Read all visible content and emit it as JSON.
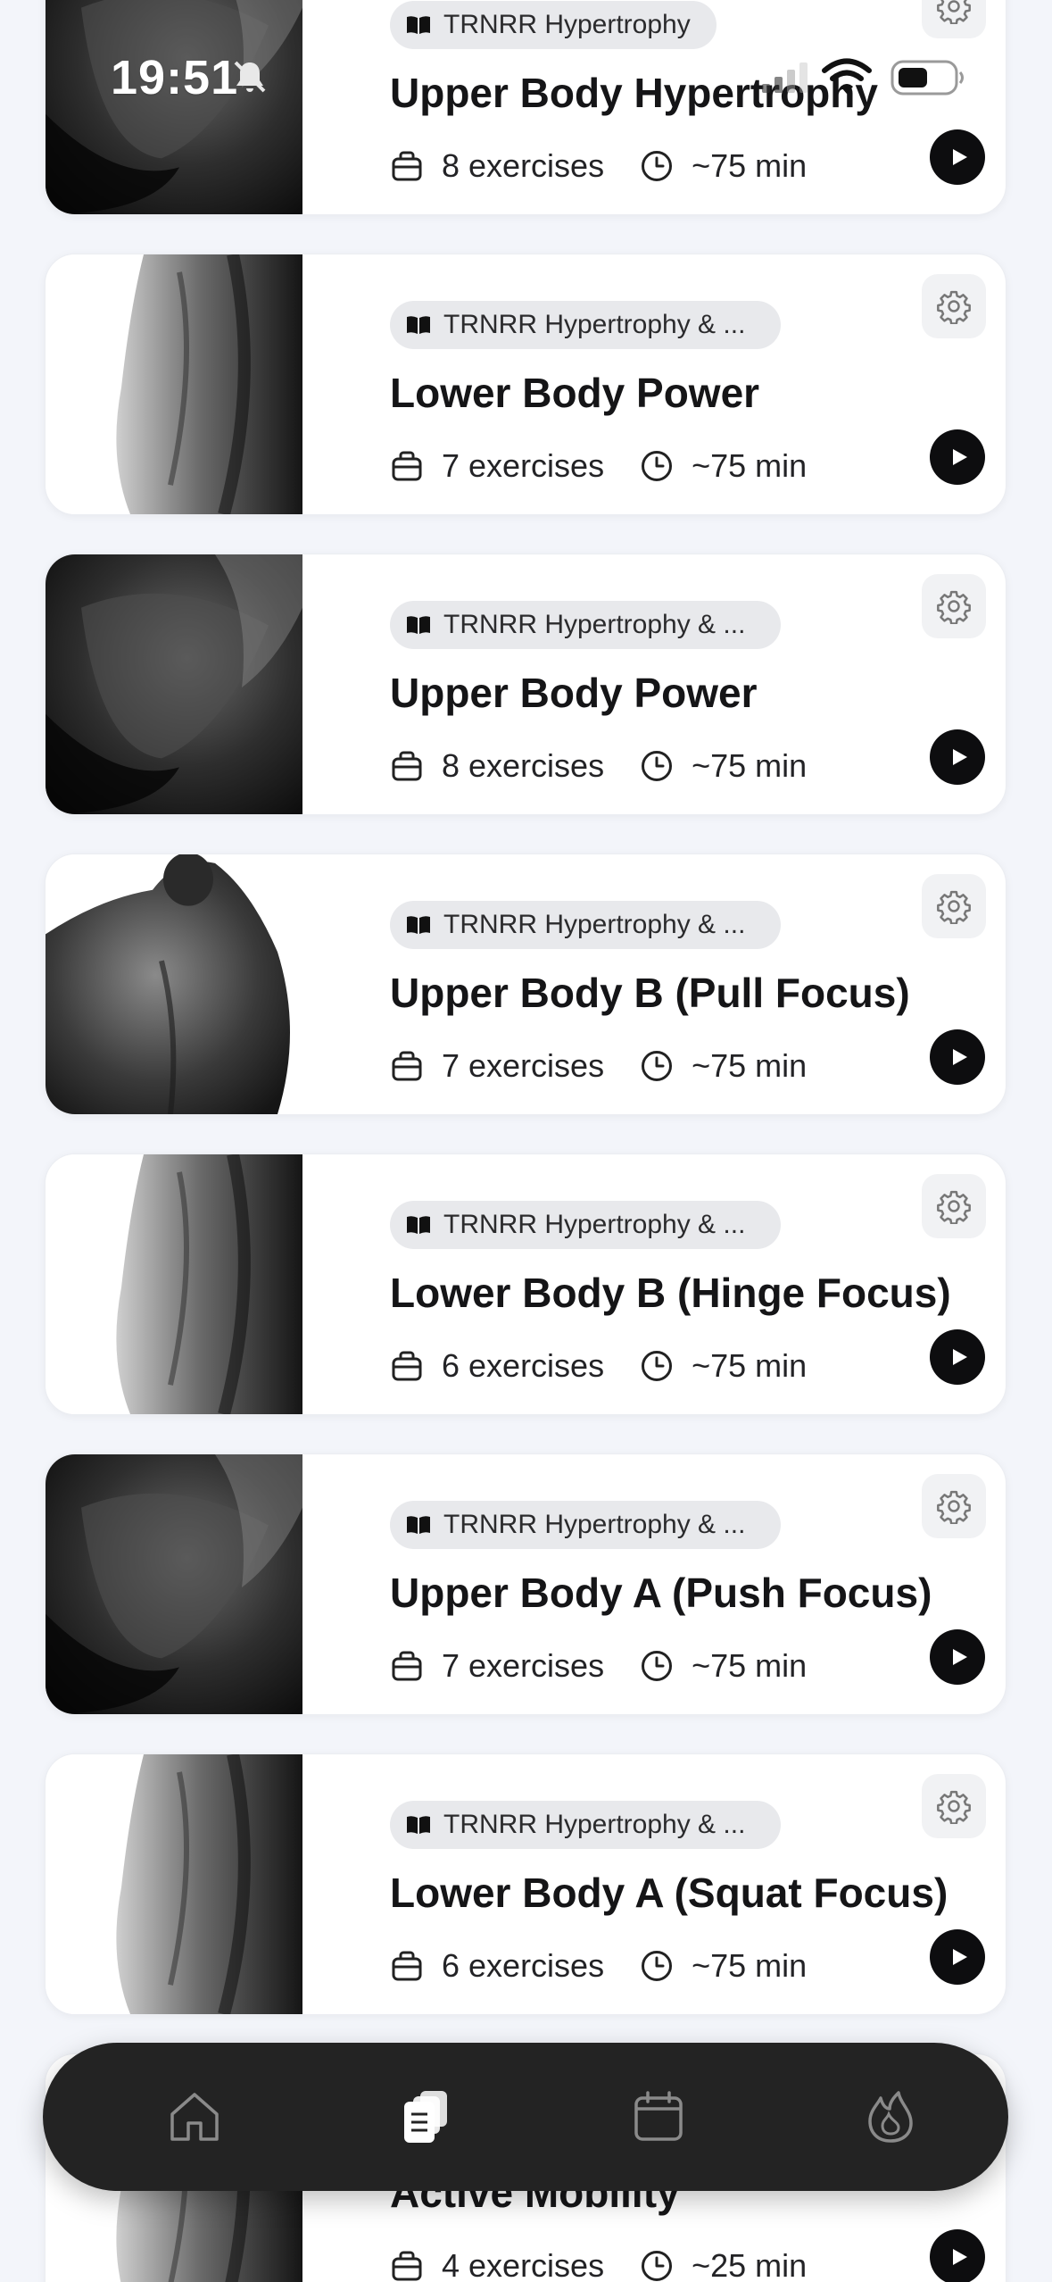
{
  "status_bar": {
    "time": "19:51"
  },
  "workouts": [
    {
      "program": "TRNRR Hypertrophy",
      "title": "Upper Body Hypertrophy",
      "exercises": "8 exercises",
      "duration": "~75 min",
      "image": "chest"
    },
    {
      "program": "TRNRR Hypertrophy & ...",
      "title": "Lower Body Power",
      "exercises": "7 exercises",
      "duration": "~75 min",
      "image": "leg"
    },
    {
      "program": "TRNRR Hypertrophy & ...",
      "title": "Upper Body Power",
      "exercises": "8 exercises",
      "duration": "~75 min",
      "image": "chest"
    },
    {
      "program": "TRNRR Hypertrophy & ...",
      "title": "Upper Body B (Pull Focus)",
      "exercises": "7 exercises",
      "duration": "~75 min",
      "image": "back"
    },
    {
      "program": "TRNRR Hypertrophy & ...",
      "title": "Lower Body B (Hinge Focus)",
      "exercises": "6 exercises",
      "duration": "~75 min",
      "image": "leg"
    },
    {
      "program": "TRNRR Hypertrophy & ...",
      "title": "Upper Body A (Push Focus)",
      "exercises": "7 exercises",
      "duration": "~75 min",
      "image": "chest"
    },
    {
      "program": "TRNRR Hypertrophy & ...",
      "title": "Lower Body A (Squat Focus)",
      "exercises": "6 exercises",
      "duration": "~75 min",
      "image": "leg"
    },
    {
      "program": "",
      "title": "Active Mobility",
      "exercises": "4 exercises",
      "duration": "~25 min",
      "image": "leg"
    }
  ],
  "bottom_nav": {
    "items": [
      {
        "icon": "home-icon",
        "active": false
      },
      {
        "icon": "workouts-icon",
        "active": true
      },
      {
        "icon": "calendar-icon",
        "active": false
      },
      {
        "icon": "flame-icon",
        "active": false
      }
    ],
    "active_color": "#ffffff",
    "inactive_color": "#8a8a8a"
  },
  "colors": {
    "background": "#f3f5fa",
    "card": "#ffffff",
    "nav": "#232323",
    "play": "#0d0d0f"
  }
}
